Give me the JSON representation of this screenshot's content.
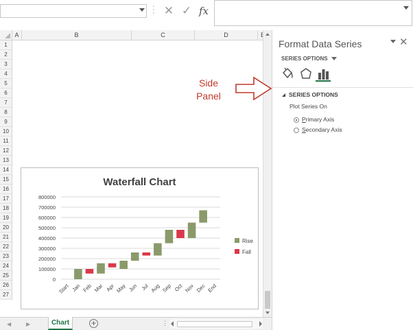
{
  "formula_bar": {
    "name_box_value": "",
    "cancel_glyph": "✕",
    "enter_glyph": "✓",
    "fx_label": "fx",
    "formula_value": ""
  },
  "grid": {
    "columns": [
      "A",
      "B",
      "C",
      "D",
      "E"
    ],
    "rows": [
      "1",
      "2",
      "3",
      "4",
      "5",
      "6",
      "7",
      "8",
      "9",
      "10",
      "11",
      "12",
      "13",
      "14",
      "15",
      "16",
      "17",
      "18",
      "19",
      "20",
      "21",
      "22",
      "23",
      "24",
      "25",
      "26",
      "27"
    ]
  },
  "chart_data": {
    "type": "bar",
    "subtype": "waterfall",
    "title": "Waterfall Chart",
    "xlabel": "",
    "ylabel": "",
    "ylim": [
      0,
      800000
    ],
    "yticks": [
      0,
      100000,
      200000,
      300000,
      400000,
      500000,
      600000,
      700000,
      800000
    ],
    "ytick_labels": [
      "0",
      "100000",
      "200000",
      "300000",
      "400000",
      "500000",
      "600000",
      "700000",
      "800000"
    ],
    "categories": [
      "Start",
      "Jan",
      "Feb",
      "Mar",
      "Apr",
      "May",
      "Jun",
      "Jul",
      "Aug",
      "Sep",
      "Oct",
      "Nov",
      "Dec",
      "End"
    ],
    "series": [
      {
        "name": "Rise",
        "color": "#8a9a6a",
        "bars": [
          null,
          [
            0,
            100000
          ],
          null,
          [
            55000,
            155000
          ],
          null,
          [
            100000,
            180000
          ],
          [
            180000,
            260000
          ],
          null,
          [
            230000,
            350000
          ],
          [
            350000,
            480000
          ],
          null,
          [
            400000,
            550000
          ],
          [
            550000,
            670000
          ],
          null
        ]
      },
      {
        "name": "Fall",
        "color": "#d9394a",
        "bars": [
          null,
          null,
          [
            55000,
            100000
          ],
          null,
          [
            115000,
            155000
          ],
          null,
          null,
          [
            230000,
            260000
          ],
          null,
          null,
          [
            400000,
            480000
          ],
          null,
          null,
          null
        ]
      }
    ],
    "grid": true,
    "legend_position": "right"
  },
  "sheet_tabs": {
    "active": "Chart",
    "add_glyph": "+",
    "prev_glyph": "◀",
    "next_glyph": "▶",
    "dots": "⋮"
  },
  "side_panel": {
    "title": "Format Data Series",
    "close_glyph": "✕",
    "series_options_dropdown": "SERIES OPTIONS",
    "section_header": "SERIES OPTIONS",
    "plot_series_on_label": "Plot Series On",
    "radio_primary_prefix": "",
    "radio_primary_underline": "P",
    "radio_primary_rest": "rimary Axis",
    "radio_secondary_prefix": "",
    "radio_secondary_underline": "S",
    "radio_secondary_rest": "econdary Axis",
    "selected_axis": "primary",
    "accent_color": "#217346"
  },
  "annotation": {
    "line1": "Side",
    "line2": "Panel",
    "color": "#c0392b"
  }
}
